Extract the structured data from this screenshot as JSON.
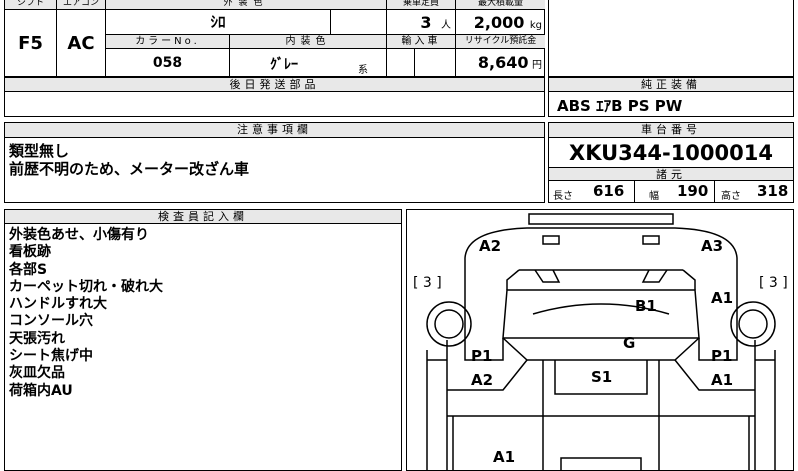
{
  "top_table": {
    "headers": {
      "shift": "シフト",
      "aircon": "エアコン",
      "exterior_color": "外装色",
      "capacity": "乗車定員",
      "max_load": "最大積載量",
      "color_no": "カラーNo.",
      "interior_color": "内装色",
      "import_car": "輸入車",
      "recycle_fee": "リサイクル預託金"
    },
    "shift": "F5",
    "aircon": "AC",
    "exterior_color": "ｼﾛ",
    "capacity": "3",
    "capacity_unit": "人",
    "max_load": "2,000",
    "max_load_unit": "kg",
    "color_no": "058",
    "interior_color": "ｸﾞﾚｰ",
    "interior_suffix": "系",
    "recycle_fee": "8,640",
    "recycle_unit": "円"
  },
  "later_parts": {
    "header": "後日発送部品",
    "value": ""
  },
  "genuine_equipment": {
    "header": "純正装備",
    "value": "ABS ｴｱB PS PW"
  },
  "notes": {
    "header": "注意事項欄",
    "lines": [
      "類型無し",
      "前歴不明のため、メーター改ざん車"
    ]
  },
  "chassis": {
    "header": "車台番号",
    "number": "XKU344-1000014"
  },
  "specs": {
    "header": "諸元",
    "length_label": "長さ",
    "length": "616",
    "width_label": "幅",
    "width": "190",
    "height_label": "高さ",
    "height": "318"
  },
  "inspector": {
    "header": "検査員記入欄",
    "lines": [
      "外装色あせ、小傷有り",
      "看板跡",
      "各部S",
      "カーペット切れ・破れ大",
      "ハンドルすれ大",
      "コンソール穴",
      "天張汚れ",
      "シート焦げ中",
      "灰皿欠品",
      "荷箱内AU"
    ]
  },
  "diagram": {
    "left_tire": "[ 3 ]",
    "right_tire": "[ 3 ]",
    "marks": {
      "a2_top": "A2",
      "a3_top": "A3",
      "b1": "B1",
      "a1_right": "A1",
      "g": "G",
      "p1_left": "P1",
      "a2_left": "A2",
      "s1": "S1",
      "p1_right": "P1",
      "a1_lower": "A1",
      "a1_bottom": "A1"
    }
  }
}
